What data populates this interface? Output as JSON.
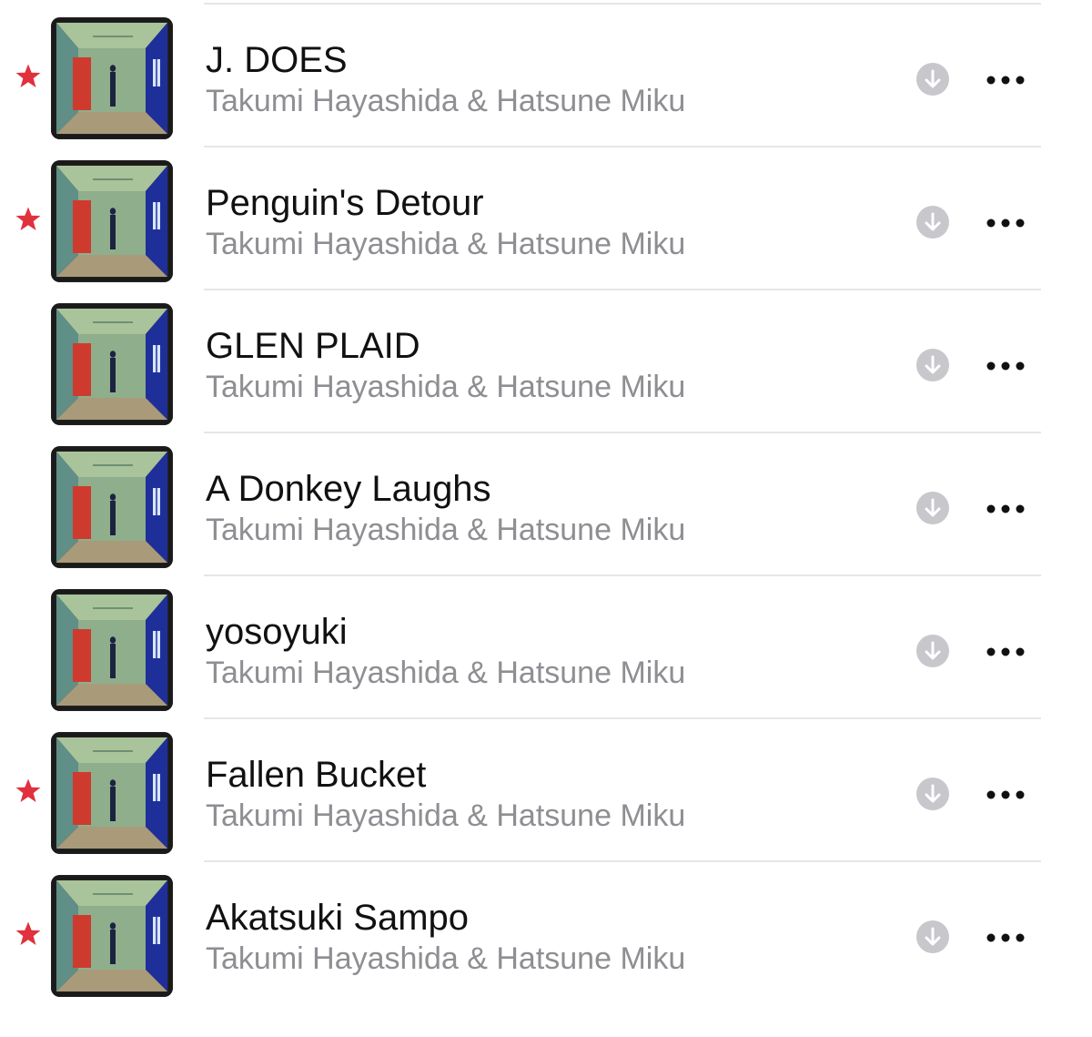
{
  "colors": {
    "star": "#e0313d",
    "title": "#111111",
    "artist": "#8e8e93",
    "download_icon": "#c7c7cc",
    "more_icon": "#111111",
    "divider": "#e6e6e9"
  },
  "tracks": [
    {
      "title": "J. DOES",
      "artist": "Takumi Hayashida & Hatsune Miku",
      "favorite": true,
      "icons": [
        "star-icon",
        "album-art",
        "download-icon",
        "more-icon"
      ]
    },
    {
      "title": "Penguin's Detour",
      "artist": "Takumi Hayashida & Hatsune Miku",
      "favorite": true,
      "icons": [
        "star-icon",
        "album-art",
        "download-icon",
        "more-icon"
      ]
    },
    {
      "title": "GLEN PLAID",
      "artist": "Takumi Hayashida & Hatsune Miku",
      "favorite": false,
      "icons": [
        "album-art",
        "download-icon",
        "more-icon"
      ]
    },
    {
      "title": "A Donkey Laughs",
      "artist": "Takumi Hayashida & Hatsune Miku",
      "favorite": false,
      "icons": [
        "album-art",
        "download-icon",
        "more-icon"
      ]
    },
    {
      "title": "yosoyuki",
      "artist": "Takumi Hayashida & Hatsune Miku",
      "favorite": false,
      "icons": [
        "album-art",
        "download-icon",
        "more-icon"
      ]
    },
    {
      "title": "Fallen Bucket",
      "artist": "Takumi Hayashida & Hatsune Miku",
      "favorite": true,
      "icons": [
        "star-icon",
        "album-art",
        "download-icon",
        "more-icon"
      ]
    },
    {
      "title": "Akatsuki Sampo",
      "artist": "Takumi Hayashida & Hatsune Miku",
      "favorite": true,
      "icons": [
        "star-icon",
        "album-art",
        "download-icon",
        "more-icon"
      ]
    }
  ]
}
